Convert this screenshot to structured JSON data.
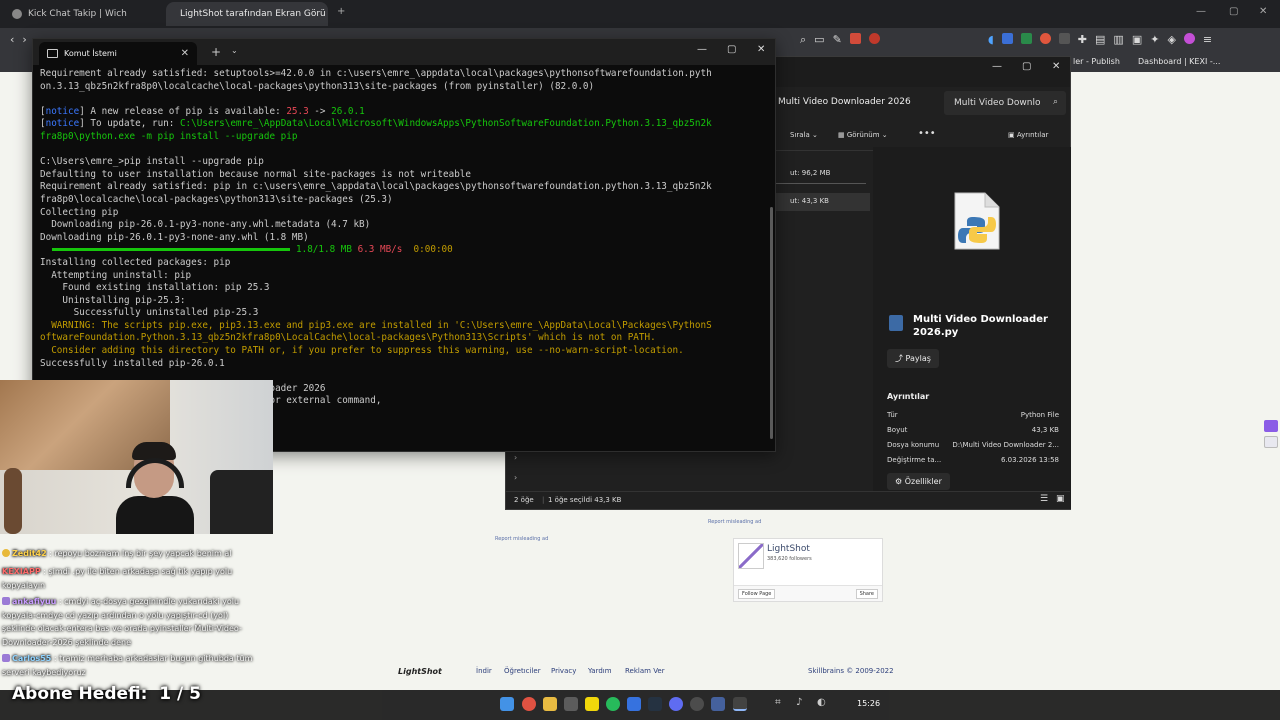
{
  "browser": {
    "tabs": [
      {
        "title": "Kick Chat Takip | Wich"
      },
      {
        "title": "LightShot tarafından Ekran Görü"
      }
    ],
    "bookmarks": [
      "ler - Publish",
      "Dashboard | KEXI -..."
    ]
  },
  "terminal": {
    "tab_title": "Komut İstemi",
    "lines": [
      [
        {
          "t": "Requirement already satisfied: setuptools>=42.0.0 in c:\\users\\emre_\\appdata\\local\\packages\\pythonsoftwarefoundation.pyth"
        }
      ],
      [
        {
          "t": "on.3.13_qbz5n2kfra8p0\\localcache\\local-packages\\python313\\site-packages (from pyinstaller) (82.0.0)"
        }
      ],
      [
        {
          "t": ""
        }
      ],
      [
        {
          "t": "[",
          "c": ""
        },
        {
          "t": "notice",
          "c": "notice"
        },
        {
          "t": "] A new release of pip is available: "
        },
        {
          "t": "25.3",
          "c": "red"
        },
        {
          "t": " -> "
        },
        {
          "t": "26.0.1",
          "c": "green"
        }
      ],
      [
        {
          "t": "[",
          "c": ""
        },
        {
          "t": "notice",
          "c": "notice"
        },
        {
          "t": "] To update, run: "
        },
        {
          "t": "C:\\Users\\emre_\\AppData\\Local\\Microsoft\\WindowsApps\\PythonSoftwareFoundation.Python.3.13_qbz5n2k",
          "c": "green"
        }
      ],
      [
        {
          "t": "fra8p0\\python.exe -m pip install --upgrade pip",
          "c": "green"
        }
      ],
      [
        {
          "t": ""
        }
      ],
      [
        {
          "t": "C:\\Users\\emre_>pip install --upgrade pip"
        }
      ],
      [
        {
          "t": "Defaulting to user installation because normal site-packages is not writeable"
        }
      ],
      [
        {
          "t": "Requirement already satisfied: pip in c:\\users\\emre_\\appdata\\local\\packages\\pythonsoftwarefoundation.python.3.13_qbz5n2k"
        }
      ],
      [
        {
          "t": "fra8p0\\localcache\\local-packages\\python313\\site-packages (25.3)"
        }
      ],
      [
        {
          "t": "Collecting pip"
        }
      ],
      [
        {
          "t": "  Downloading pip-26.0.1-py3-none-any.whl.metadata (4.7 kB)"
        }
      ],
      [
        {
          "t": "Downloading pip-26.0.1-py3-none-any.whl (1.8 MB)"
        }
      ],
      [
        {
          "bar": true
        },
        {
          "t": "1.8/1.8 MB ",
          "c": "green"
        },
        {
          "t": "6.3 MB/s",
          "c": "red"
        },
        {
          "t": "  0:00:00",
          "c": "yellow"
        }
      ],
      [
        {
          "t": "Installing collected packages: pip"
        }
      ],
      [
        {
          "t": "  Attempting uninstall: pip"
        }
      ],
      [
        {
          "t": "    Found existing installation: pip 25.3"
        }
      ],
      [
        {
          "t": "    Uninstalling pip-25.3:"
        }
      ],
      [
        {
          "t": "      Successfully uninstalled pip-25.3"
        }
      ],
      [
        {
          "t": "  WARNING: The scripts pip.exe, pip3.13.exe and pip3.exe are installed in 'C:\\Users\\emre_\\AppData\\Local\\Packages\\PythonS",
          "c": "yellow"
        }
      ],
      [
        {
          "t": "oftwareFoundation.Python.3.13_qbz5n2kfra8p0\\LocalCache\\local-packages\\Python313\\Scripts' which is not on PATH.",
          "c": "yellow"
        }
      ],
      [
        {
          "t": "  Consider adding this directory to PATH or, if you prefer to suppress this warning, use --no-warn-script-location.",
          "c": "yellow"
        }
      ],
      [
        {
          "t": "Successfully installed pip-26.0.1"
        }
      ],
      [
        {
          "t": ""
        }
      ],
      [
        {
          "t": "                                 eo Downloader 2026"
        }
      ],
      [
        {
          "t": "                                 nternal or external command,"
        }
      ]
    ]
  },
  "explorer": {
    "path": "Multi Video Downloader 2026",
    "search": "Multi Video Downlo",
    "toolbar": {
      "sort": "Sırala",
      "view": "Görünüm",
      "more": "•••",
      "details": "Ayrıntılar"
    },
    "sizes": [
      "ut: 96,2 MB",
      "ut: 43,3 KB"
    ],
    "file_name": "Multi Video Downloader 2026.py",
    "share": "Paylaş",
    "details_heading": "Ayrıntılar",
    "details": [
      {
        "k": "Tür",
        "v": "Python File"
      },
      {
        "k": "Boyut",
        "v": "43,3 KB"
      },
      {
        "k": "Dosya konumu",
        "v": "D:\\Multi Video Downloader 2..."
      },
      {
        "k": "Değiştirme ta...",
        "v": "6.03.2026 13:58"
      }
    ],
    "properties": "Özellikler",
    "status_count": "2 öğe",
    "status_sel": "1 öğe seçildi  43,3 KB"
  },
  "lightshot": {
    "name": "LightShot",
    "followers": "383,620 followers",
    "follow": "Follow Page",
    "share": "Share",
    "report1": "Report misleading ad",
    "report2": "Report misleading ad"
  },
  "footer": {
    "logo": "LightShot",
    "links": [
      "İndir",
      "Öğretıciler",
      "Privacy",
      "Yardım",
      "Reklam Ver"
    ],
    "copyright": "Skillbrains © 2009-2022"
  },
  "chat": [
    {
      "user": "Zedit42",
      "color": "#ffd24a",
      "text": "repoyu bozmam lnş bir şey yapcak benim al"
    },
    {
      "user": "KEXIAPP",
      "color": "#ff6a6a",
      "text": "şimdi .py ile biten arkadaşa sağ tık yapıp yolu kopyalayın"
    },
    {
      "user": "ankafiyuu",
      "color": "#c89cff",
      "text": "cmdyi aç-dosya gezginindle yukarıdaki yolu kopyala-cmdye cd yazıp ardından o yolu yapıştır-cd (yol) şeklinde olacak-entera bas ve orada pyinstaller Multi-Video-Downloader-2026 şeklinde dene"
    },
    {
      "user": "Carlos55",
      "color": "#8fd3ff",
      "text": "tramiz merhaba arkadaslar bugun githubda tüm serveri kaybediyoruz"
    }
  ],
  "goal_label": "Abone Hedefi:",
  "goal_value": "1 / 5",
  "clock": "15:26"
}
